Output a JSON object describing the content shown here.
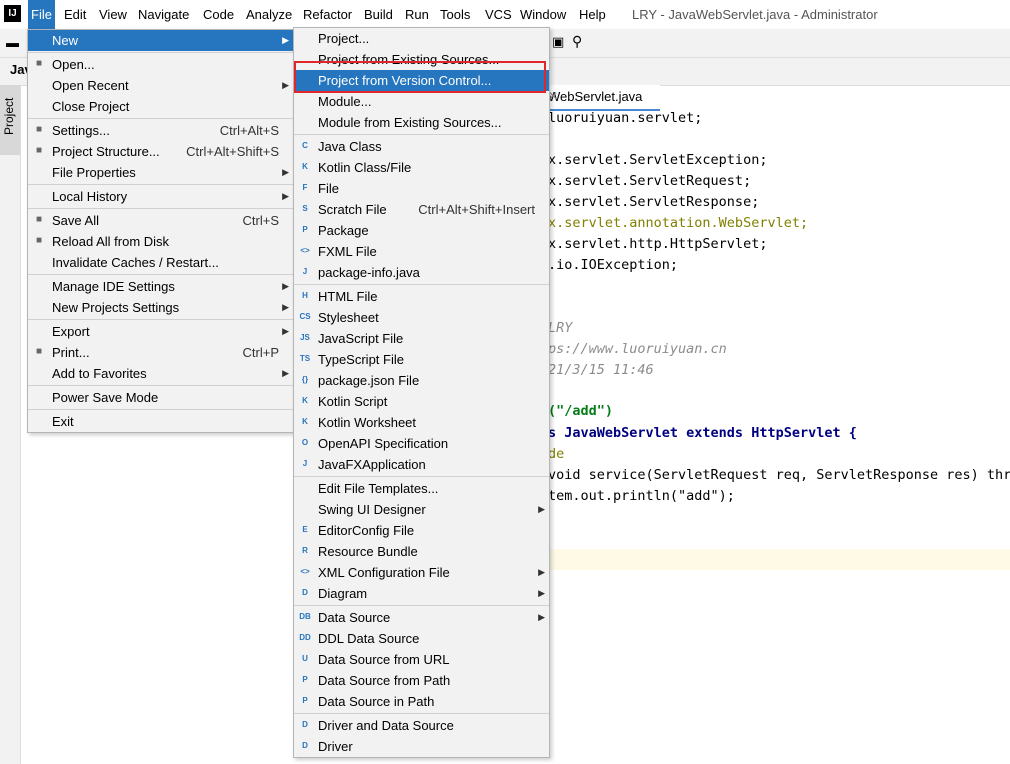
{
  "window": {
    "title": "LRY - JavaWebServlet.java - Administrator",
    "logo": "IJ"
  },
  "menubar": [
    "File",
    "Edit",
    "View",
    "Navigate",
    "Code",
    "Analyze",
    "Refactor",
    "Build",
    "Run",
    "Tools",
    "VCS",
    "Window",
    "Help"
  ],
  "sidebar": {
    "project_tab": "Project",
    "project_name": "Jav"
  },
  "editor": {
    "tab_label": "WebServlet.java",
    "lines": [
      "luoruiyuan.servlet;",
      "x.servlet.ServletException;",
      "x.servlet.ServletRequest;",
      "x.servlet.ServletResponse;",
      "x.servlet.annotation.WebServlet;",
      "x.servlet.http.HttpServlet;",
      ".io.IOException;",
      "LRY",
      "ps://www.luoruiyuan.cn",
      "21/3/15 11:46",
      "(\"/add\")",
      "s JavaWebServlet extends HttpServlet {",
      "de",
      "void service(ServletRequest req, ServletResponse res) thro",
      "tem.out.println(\"add\");"
    ]
  },
  "file_menu": {
    "items": [
      {
        "label": "New",
        "shortcut": "",
        "submenu": true,
        "icon": ""
      },
      {
        "sep": true
      },
      {
        "label": "Open...",
        "shortcut": "",
        "icon": "folder-icon"
      },
      {
        "label": "Open Recent",
        "submenu": true
      },
      {
        "label": "Close Project"
      },
      {
        "sep": true
      },
      {
        "label": "Settings...",
        "shortcut": "Ctrl+Alt+S",
        "icon": "wrench-icon"
      },
      {
        "label": "Project Structure...",
        "shortcut": "Ctrl+Alt+Shift+S",
        "icon": "structure-icon"
      },
      {
        "label": "File Properties",
        "submenu": true
      },
      {
        "sep": true
      },
      {
        "label": "Local History",
        "submenu": true
      },
      {
        "sep": true
      },
      {
        "label": "Save All",
        "shortcut": "Ctrl+S",
        "icon": "save-icon"
      },
      {
        "label": "Reload All from Disk",
        "icon": "reload-icon"
      },
      {
        "label": "Invalidate Caches / Restart..."
      },
      {
        "sep": true
      },
      {
        "label": "Manage IDE Settings",
        "submenu": true
      },
      {
        "label": "New Projects Settings",
        "submenu": true
      },
      {
        "sep": true
      },
      {
        "label": "Export",
        "submenu": true
      },
      {
        "label": "Print...",
        "shortcut": "Ctrl+P",
        "icon": "print-icon"
      },
      {
        "label": "Add to Favorites",
        "submenu": true
      },
      {
        "sep": true
      },
      {
        "label": "Power Save Mode"
      },
      {
        "sep": true
      },
      {
        "label": "Exit"
      }
    ]
  },
  "new_menu": {
    "items": [
      {
        "label": "Project..."
      },
      {
        "label": "Project from Existing Sources..."
      },
      {
        "label": "Project from Version Control..."
      },
      {
        "label": "Module..."
      },
      {
        "label": "Module from Existing Sources..."
      },
      {
        "sep": true
      },
      {
        "label": "Java Class",
        "icon": "C"
      },
      {
        "label": "Kotlin Class/File",
        "icon": "K"
      },
      {
        "label": "File",
        "icon": "F"
      },
      {
        "label": "Scratch File",
        "shortcut": "Ctrl+Alt+Shift+Insert",
        "icon": "S"
      },
      {
        "label": "Package",
        "icon": "P"
      },
      {
        "label": "FXML File",
        "icon": "<>"
      },
      {
        "label": "package-info.java",
        "icon": "J"
      },
      {
        "sep": true
      },
      {
        "label": "HTML File",
        "icon": "H"
      },
      {
        "label": "Stylesheet",
        "icon": "CSS"
      },
      {
        "label": "JavaScript File",
        "icon": "JS"
      },
      {
        "label": "TypeScript File",
        "icon": "TS"
      },
      {
        "label": "package.json File",
        "icon": "{}"
      },
      {
        "label": "Kotlin Script",
        "icon": "K"
      },
      {
        "label": "Kotlin Worksheet",
        "icon": "K"
      },
      {
        "label": "OpenAPI Specification",
        "icon": "O"
      },
      {
        "label": "JavaFXApplication",
        "icon": "J"
      },
      {
        "sep": true
      },
      {
        "label": "Edit File Templates..."
      },
      {
        "label": "Swing UI Designer",
        "submenu": true
      },
      {
        "label": "EditorConfig File",
        "icon": "E"
      },
      {
        "label": "Resource Bundle",
        "icon": "R"
      },
      {
        "label": "XML Configuration File",
        "submenu": true,
        "icon": "<>"
      },
      {
        "label": "Diagram",
        "submenu": true,
        "icon": "D"
      },
      {
        "sep": true
      },
      {
        "label": "Data Source",
        "submenu": true,
        "icon": "DB"
      },
      {
        "label": "DDL Data Source",
        "icon": "DDL"
      },
      {
        "label": "Data Source from URL",
        "icon": "U"
      },
      {
        "label": "Data Source from Path",
        "icon": "P"
      },
      {
        "label": "Data Source in Path",
        "icon": "P"
      },
      {
        "sep": true
      },
      {
        "label": "Driver and Data Source",
        "icon": "D"
      },
      {
        "label": "Driver",
        "icon": "D"
      }
    ]
  }
}
